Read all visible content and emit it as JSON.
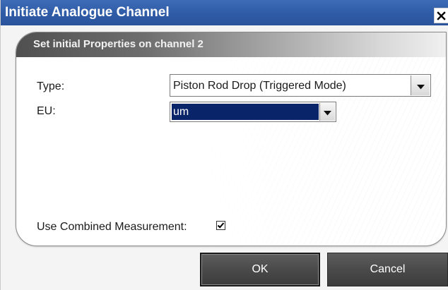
{
  "window": {
    "title": "Initiate Analogue Channel",
    "close_icon": "close-icon"
  },
  "panel": {
    "header": "Set initial Properties on channel 2"
  },
  "form": {
    "type_label": "Type:",
    "type_value": "Piston Rod Drop (Triggered Mode)",
    "eu_label": "EU:",
    "eu_value": "um",
    "combined_label": "Use Combined Measurement:",
    "combined_checked": true
  },
  "buttons": {
    "ok_label": "OK",
    "cancel_label": "Cancel"
  },
  "colors": {
    "titlebar": "#2f5ba6",
    "selection": "#0a246a",
    "button": "#4a4a4a"
  }
}
